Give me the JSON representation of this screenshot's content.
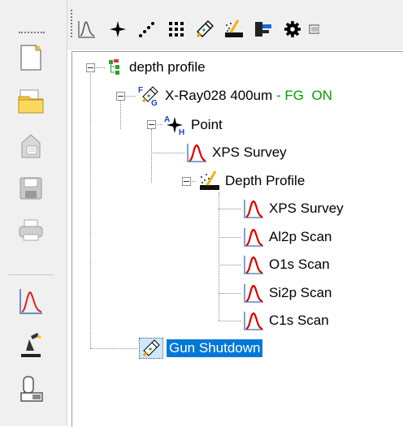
{
  "left_toolbar": {
    "items": [
      {
        "name": "new-document-icon"
      },
      {
        "name": "open-folder-icon"
      },
      {
        "name": "import-icon"
      },
      {
        "name": "save-icon"
      },
      {
        "name": "print-icon"
      },
      {
        "name": "spectrum-icon"
      },
      {
        "name": "microscope-icon"
      },
      {
        "name": "instrument-icon"
      }
    ]
  },
  "top_toolbar": {
    "items": [
      {
        "name": "spectrum-peak-icon"
      },
      {
        "name": "point-icon"
      },
      {
        "name": "line-points-icon"
      },
      {
        "name": "grid-points-icon"
      },
      {
        "name": "gun-icon"
      },
      {
        "name": "depth-profile-icon"
      },
      {
        "name": "stage-icon"
      },
      {
        "name": "settings-gear-icon"
      },
      {
        "name": "more-icon"
      }
    ]
  },
  "tree": {
    "root": {
      "label": "depth profile"
    },
    "gun": {
      "label": "X-Ray028 400um",
      "sep": " - ",
      "status": "FG  ON"
    },
    "point": {
      "label": "Point"
    },
    "xps_survey_1": {
      "label": "XPS Survey"
    },
    "depth": {
      "label": "Depth Profile"
    },
    "children": [
      {
        "label": "XPS Survey"
      },
      {
        "label": "Al2p Scan"
      },
      {
        "label": "O1s Scan"
      },
      {
        "label": "Si2p Scan"
      },
      {
        "label": "C1s Scan"
      }
    ],
    "shutdown": {
      "label": "Gun Shutdown"
    }
  },
  "colors": {
    "selection": "#0078d7",
    "status_green": "#00a000",
    "peak_red": "#e00000"
  }
}
